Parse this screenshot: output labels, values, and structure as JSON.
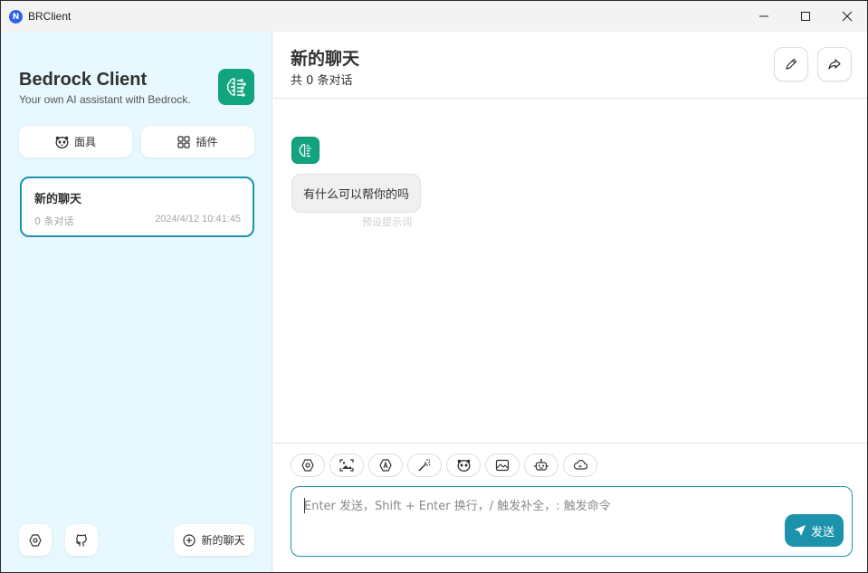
{
  "window": {
    "app_title": "BRClient",
    "logo_letter": "N"
  },
  "sidebar": {
    "brand_title": "Bedrock Client",
    "brand_subtitle": "Your own AI assistant with Bedrock.",
    "mask_label": "面具",
    "plugins_label": "插件",
    "chats": [
      {
        "title": "新的聊天",
        "count": "0 条对话",
        "date": "2024/4/12 10:41:45"
      }
    ],
    "new_chat_label": "新的聊天"
  },
  "main": {
    "title": "新的聊天",
    "subtitle": "共 0 条对话",
    "message": {
      "text": "有什么可以帮你的吗",
      "hint": "预设提示词"
    },
    "composer": {
      "placeholder": "Enter 发送，Shift + Enter 换行，/ 触发补全，: 触发命令",
      "send_label": "发送"
    }
  },
  "colors": {
    "accent": "#1d93ab",
    "brand_green": "#12a47f",
    "sidebar_bg": "#e7f8ff"
  }
}
